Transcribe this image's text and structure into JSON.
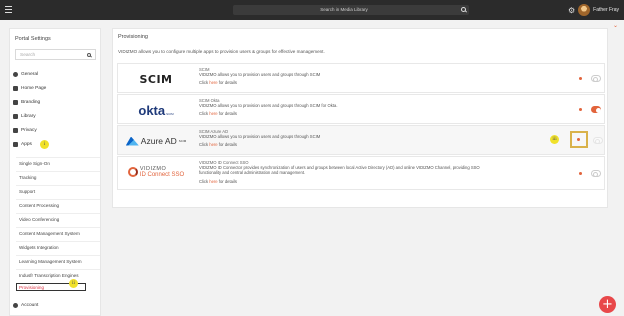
{
  "topbar": {
    "search_placeholder": "Search in Media Library",
    "user_name": "Father Fray"
  },
  "sidebar": {
    "title": "Portal Settings",
    "search_placeholder": "Search",
    "items": [
      {
        "label": "General"
      },
      {
        "label": "Home Page"
      },
      {
        "label": "Branding"
      },
      {
        "label": "Library"
      },
      {
        "label": "Privacy"
      },
      {
        "label": "Apps"
      }
    ],
    "apps_sub": [
      {
        "label": "Single Sign-On"
      },
      {
        "label": "Tracking"
      },
      {
        "label": "Support"
      },
      {
        "label": "Content Processing"
      },
      {
        "label": "Video Conferencing"
      },
      {
        "label": "Content Management System"
      },
      {
        "label": "Widgets Integration"
      },
      {
        "label": "Learning Management System"
      },
      {
        "label": "Indusfr Transcription Engines"
      },
      {
        "label": "Provisioning"
      }
    ],
    "account_label": "Account"
  },
  "markers": {
    "i": "i",
    "ii": "ii",
    "iii": "iii"
  },
  "main": {
    "title": "Provisioning",
    "description": "VIDIZMO allows you to configure multiple apps to provision users & groups for effective management.",
    "providers": [
      {
        "logo_text": "SCIM",
        "name": "SCIM",
        "desc": "VIDIZMO allows you to provision users and groups through SCIM",
        "link_prefix": "Click ",
        "link_text": "here",
        "link_suffix": " for details",
        "enabled": false
      },
      {
        "logo_text": "okta",
        "logo_sub": "SCIM",
        "name": "SCIM Okta",
        "desc": "VIDIZMO allows you to provision users and groups through SCIM for Okta.",
        "link_prefix": "Click ",
        "link_text": "here",
        "link_suffix": " for details",
        "enabled": true
      },
      {
        "logo_text": "Azure AD",
        "logo_sub": "SCIM",
        "name": "SCIM Azure AD",
        "desc": "VIDIZMO allows you to provision users and groups through SCIM",
        "link_prefix": "Click ",
        "link_text": "here",
        "link_suffix": " for details",
        "enabled": false
      },
      {
        "logo_text": "VIDIZMO",
        "logo_sub": "ID Connect SSO",
        "name": "VIDIZMO ID Connect SSO",
        "desc": "VIDIZMO ID Connector provides synchronization of users and groups between local Active Directory (AD) and online VIDIZMO Channel, providing SSO functionality and central administration and management.",
        "link_prefix": "Click ",
        "link_text": "here",
        "link_suffix": " for details",
        "enabled": false
      }
    ]
  },
  "colors": {
    "accent": "#e2643c",
    "marker": "#f0e12b",
    "fab": "#e8484a"
  }
}
